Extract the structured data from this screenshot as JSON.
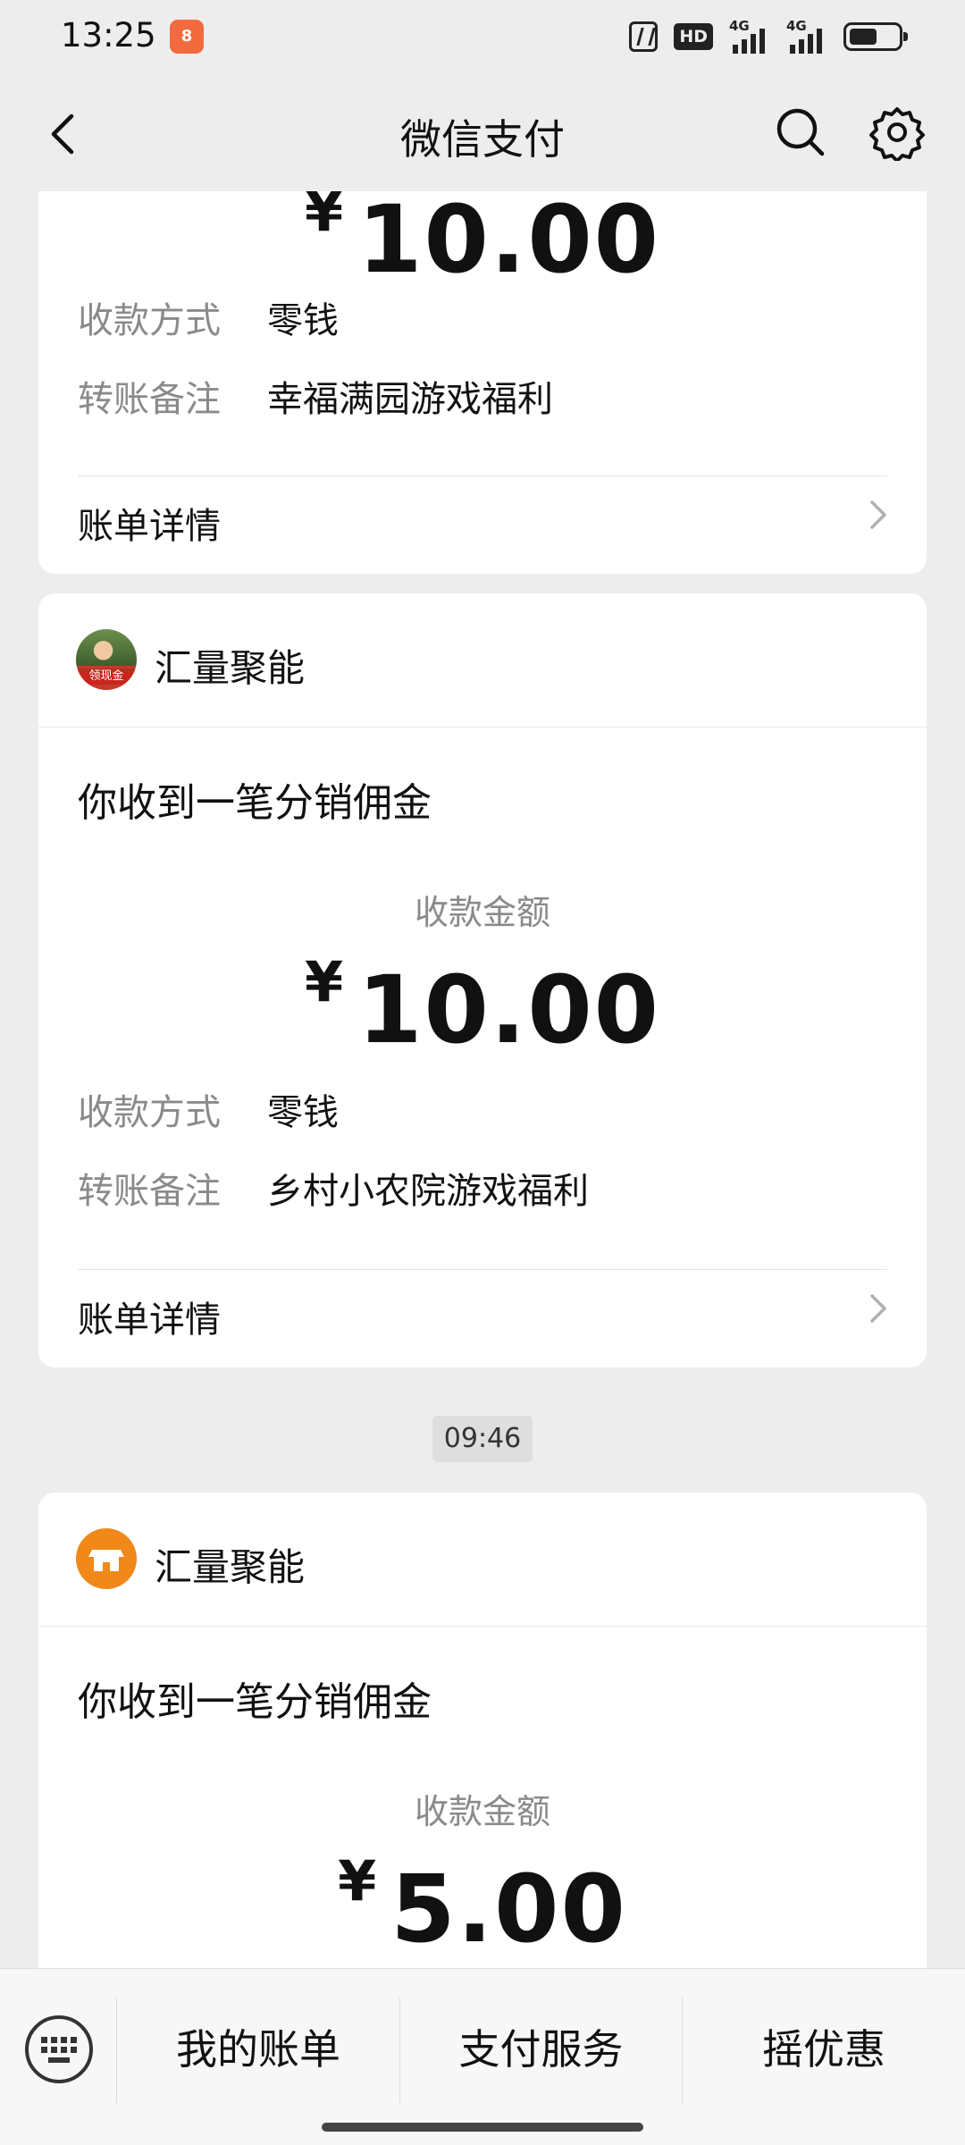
{
  "status_bar": {
    "time": "13:25",
    "app_icon_label": "8",
    "hd_label": "HD",
    "sim1_tag": "4G",
    "sim2_tag": "4G"
  },
  "header": {
    "title": "微信支付"
  },
  "card_top": {
    "amount_currency": "¥",
    "amount_value": "10.00",
    "method_label": "收款方式",
    "method_value": "零钱",
    "remark_label": "转账备注",
    "remark_value": "幸福满园游戏福利",
    "detail_label": "账单详情"
  },
  "card_middle": {
    "avatar_badge": "领现金",
    "merchant": "汇量聚能",
    "notice": "你收到一笔分销佣金",
    "amount_label": "收款金额",
    "amount_currency": "¥",
    "amount_value": "10.00",
    "method_label": "收款方式",
    "method_value": "零钱",
    "remark_label": "转账备注",
    "remark_value": "乡村小农院游戏福利",
    "detail_label": "账单详情"
  },
  "timestamp": "09:46",
  "card_bottom": {
    "merchant": "汇量聚能",
    "notice": "你收到一笔分销佣金",
    "amount_label": "收款金额",
    "amount_currency": "¥",
    "amount_value": "5.00"
  },
  "bottom_menu": {
    "items": [
      {
        "label": "我的账单"
      },
      {
        "label": "支付服务"
      },
      {
        "label": "摇优惠"
      }
    ]
  },
  "icons": [
    "back-icon",
    "search-icon",
    "gear-icon",
    "chevron-right-icon",
    "store-icon",
    "keyboard-icon"
  ],
  "colors": {
    "background": "#ededed",
    "card": "#ffffff",
    "store_icon": "#f0881a",
    "muted_text": "#8a8a8a"
  }
}
